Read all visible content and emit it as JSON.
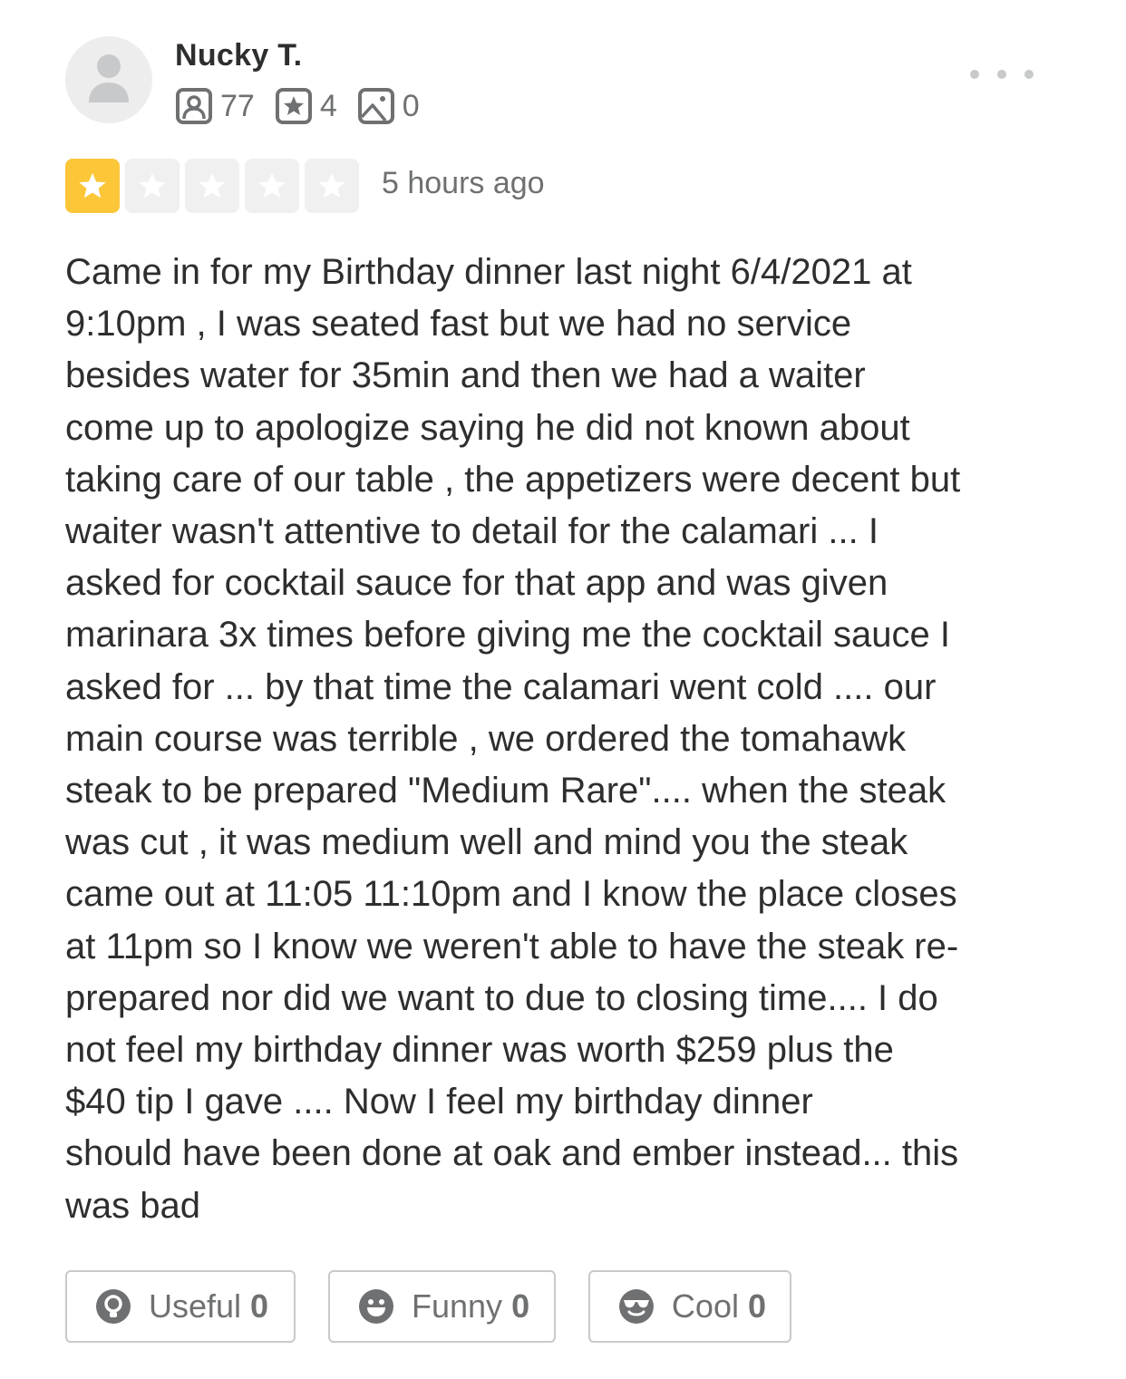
{
  "reviewer": {
    "name": "Nucky T.",
    "friends_count": "77",
    "reviews_count": "4",
    "photos_count": "0",
    "icons": [
      "avatar-placeholder-icon",
      "friends-icon",
      "star-badge-icon",
      "photo-icon"
    ]
  },
  "menu": {
    "icon": "more-options-icon"
  },
  "rating": {
    "value": 1,
    "max": 5,
    "filled_color": "#fcc639",
    "empty_color": "#f0f0f0"
  },
  "timestamp": "5 hours ago",
  "review_text": "Came in for my Birthday dinner last night 6/4/2021 at\n9:10pm , I was seated fast but we had no service\nbesides water for 35min and then we had a waiter\ncome up to apologize saying he did not known about\ntaking care of our table , the appetizers were decent but\nwaiter wasn't attentive to detail for the calamari ... I\nasked for cocktail sauce for that app and was given\nmarinara 3x times before giving me the cocktail sauce I\nasked for ... by that time the calamari went cold .... our\nmain course was terrible , we ordered the tomahawk\nsteak to be prepared \"Medium Rare\".... when the steak\nwas cut , it was medium well and mind you the steak\ncame out at 11:05 11:10pm and I know the place closes\nat 11pm so I know we weren't able to have the steak re-\nprepared nor did we want to due to closing time.... I do\nnot feel my birthday dinner was worth $259 plus the\n$40 tip I gave       .... Now I feel my birthday dinner\nshould have been done at oak and ember instead... this\nwas bad",
  "actions": {
    "useful": {
      "label": "Useful",
      "count": "0",
      "icon": "lightbulb-icon"
    },
    "funny": {
      "label": "Funny",
      "count": "0",
      "icon": "smiley-icon"
    },
    "cool": {
      "label": "Cool",
      "count": "0",
      "icon": "sunglasses-icon"
    }
  },
  "colors": {
    "text": "#2d2e2f",
    "muted": "#6e7072",
    "border": "#c8c9ca",
    "star": "#fcc639"
  }
}
